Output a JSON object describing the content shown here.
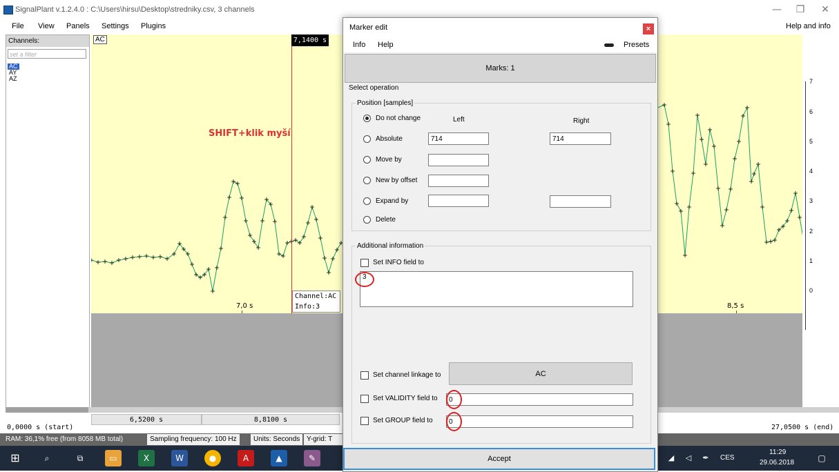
{
  "window": {
    "title": "SignalPlant v.1.2.4.0 : C:\\Users\\hirsu\\Desktop\\stredniky.csv, 3 channels",
    "minimize": "—",
    "restore": "❐",
    "close": "✕"
  },
  "menu": {
    "file": "File",
    "view": "View",
    "panels": "Panels",
    "settings": "Settings",
    "plugins": "Plugins",
    "help_and_info": "Help and info"
  },
  "channels": {
    "header": "Channels:",
    "filter_placeholder": "set a filter",
    "items": [
      "AC",
      "AY",
      "AZ"
    ]
  },
  "plot": {
    "channel_label": "AC",
    "cursor_time": "7,1400 s",
    "annotation": "SHIFT+klik myší",
    "marker_channel": "Channel:AC",
    "marker_info": "Info:3",
    "x_label_left": "7,0 s",
    "x_label_right": "8,5 s",
    "y_ticks": [
      "7",
      "6",
      "5",
      "4",
      "3",
      "2",
      "1",
      "0"
    ],
    "trace_color": "#1aa06a",
    "cursor_color": "#ee3333"
  },
  "timeline": {
    "start": "0,0000 s (start)",
    "view_start": "6,5200 s",
    "view_end": "8,8100 s",
    "end": "27,0500 s (end)"
  },
  "statusbar": {
    "ram": "RAM: 36,1% free (from 8058 MB total)",
    "sampling": "Sampling frequency: 100 Hz",
    "units": "Units: Seconds",
    "ygrid": "Y-grid: T"
  },
  "taskbar": {
    "language": "CES",
    "time": "11:29",
    "date": "29.06.2018"
  },
  "dialog": {
    "title": "Marker edit",
    "close": "×",
    "menu_info": "Info",
    "menu_help": "Help",
    "presets": "Presets",
    "marks": "Marks: 1",
    "select_operation": "Select operation",
    "position_group": "Position [samples]",
    "col_left": "Left",
    "col_right": "Right",
    "options": {
      "do_not_change": "Do not change",
      "absolute": "Absolute",
      "move_by": "Move by",
      "new_by_offset": "New by offset",
      "expand_by": "Expand by",
      "delete": "Delete"
    },
    "absolute_left": "714",
    "absolute_right": "714",
    "additional_group": "Additional information",
    "set_info": "Set INFO field to",
    "info_value": "3",
    "set_channel_linkage": "Set channel linkage to",
    "channel_linkage_value": "AC",
    "set_validity": "Set VALIDITY field to",
    "validity_value": "0",
    "set_group": "Set GROUP field to",
    "group_value": "0",
    "accept": "Accept"
  }
}
